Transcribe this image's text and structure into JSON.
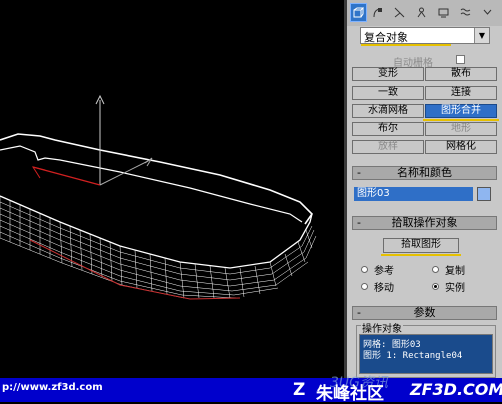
{
  "panel": {
    "tabs": [
      "create-icon",
      "modify-icon",
      "hierarchy-icon",
      "motion-icon",
      "display-icon",
      "utilities-icon"
    ],
    "dropdown_value": "复合对象",
    "auto_grid_label": "自动栅格",
    "buttons": [
      "变形",
      "散布",
      "一致",
      "连接",
      "水滴网格",
      "图形合并",
      "布尔",
      "地形",
      "放样",
      "网格化"
    ],
    "name_color_title": "名称和颜色",
    "object_name": "图形03",
    "pick_title": "拾取操作对象",
    "pick_button": "拾取图形",
    "radio_reference": "参考",
    "radio_copy": "复制",
    "radio_move": "移动",
    "radio_instance": "实例",
    "params_title": "参数",
    "operands_label": "操作对象",
    "operands": [
      "网格: 图形03",
      "图形 1: Rectangle04"
    ],
    "minus": "-"
  },
  "footer": {
    "url": "p://www.zf3d.com",
    "logo": "Z",
    "site": "朱峰社区",
    "site_en": "ZF3D.COM",
    "watermark": "3UG资讯"
  },
  "colors": {
    "highlight": "#2f6fc7",
    "underline": "#e6c000",
    "footer": "#0000cc"
  }
}
